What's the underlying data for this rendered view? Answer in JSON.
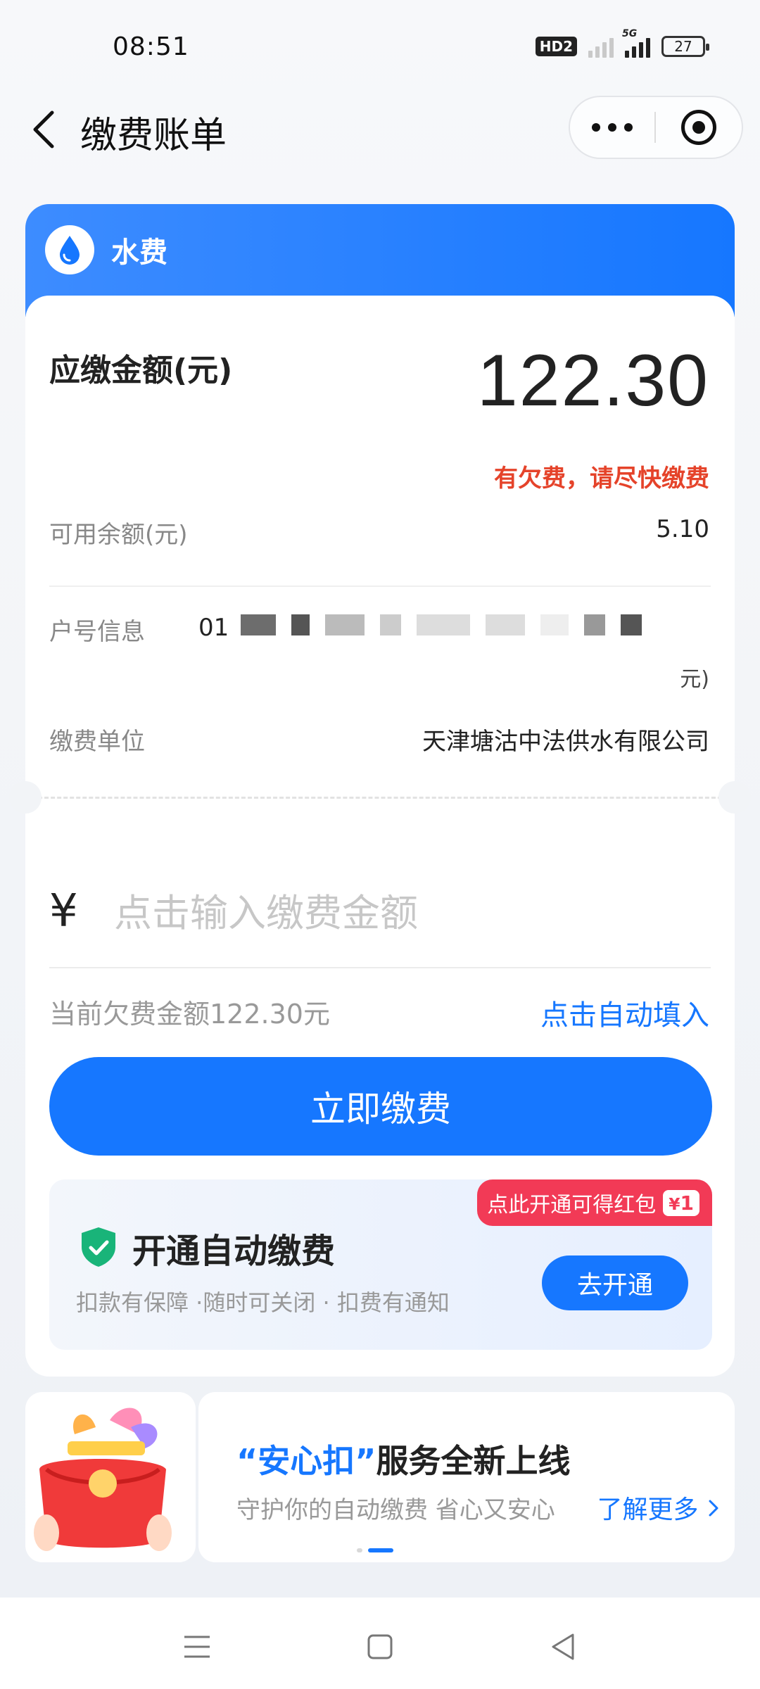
{
  "status_bar": {
    "time": "08:51",
    "hd_badge": "HD2",
    "network": "5G",
    "battery": "27"
  },
  "nav": {
    "title": "缴费账单",
    "back_icon": "chevron-left-icon",
    "more_icon": "more-dots-icon",
    "close_icon": "target-circle-icon"
  },
  "bill": {
    "category": "水费",
    "category_icon": "water-drop-icon",
    "amount_label": "应缴金额(元)",
    "amount_value": "122.30",
    "warning": "有欠费，请尽快缴费",
    "balance_label": "可用余额(元)",
    "balance_value": "5.10",
    "account_label": "户号信息",
    "account_value_visible_prefix": "01",
    "account_value_tail": "元)",
    "company_label": "缴费单位",
    "company_value": "天津塘沽中法供水有限公司"
  },
  "payment": {
    "currency_symbol": "¥",
    "input_placeholder": "点击输入缴费金额",
    "input_value": "",
    "arrears_text": "当前欠费金额122.30元",
    "autofill_link": "点击自动填入",
    "pay_button": "立即缴费"
  },
  "auto_pay": {
    "promo_text": "点此开通可得红包",
    "promo_amount_symbol": "¥",
    "promo_amount": "1",
    "title": "开通自动缴费",
    "description": "扣款有保障 ·随时可关闭 · 扣费有通知",
    "enable_button": "去开通",
    "shield_icon": "shield-check-icon"
  },
  "banner": {
    "title_quote_open": "“",
    "title_highlight": "安心扣",
    "title_quote_close": "”",
    "title_rest": "服务全新上线",
    "subtitle": "守护你的自动缴费 省心又安心",
    "learn_more": "了解更多",
    "learn_more_icon": "chevron-right-icon",
    "image_icon": "red-envelope-icon"
  },
  "colors": {
    "accent": "#1677ff",
    "warning": "#e5432a",
    "promo": "#f23a56",
    "shield": "#19b479"
  }
}
